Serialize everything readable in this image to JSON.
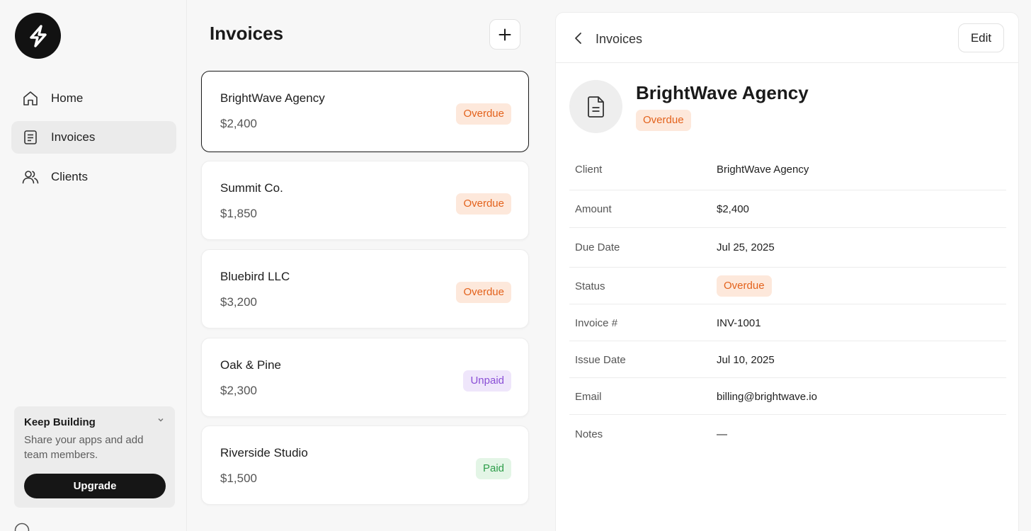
{
  "sidebar": {
    "items": [
      {
        "label": "Home",
        "icon": "home-icon"
      },
      {
        "label": "Invoices",
        "icon": "invoice-icon",
        "active": true
      },
      {
        "label": "Clients",
        "icon": "users-icon"
      }
    ],
    "promo": {
      "title": "Keep Building",
      "text": "Share your apps and add team members.",
      "button": "Upgrade"
    }
  },
  "list": {
    "title": "Invoices",
    "cards": [
      {
        "name": "BrightWave Agency",
        "amount": "$2,400",
        "status": "Overdue"
      },
      {
        "name": "Summit Co.",
        "amount": "$1,850",
        "status": "Overdue"
      },
      {
        "name": "Bluebird LLC",
        "amount": "$3,200",
        "status": "Overdue"
      },
      {
        "name": "Oak & Pine",
        "amount": "$2,300",
        "status": "Unpaid"
      },
      {
        "name": "Riverside Studio",
        "amount": "$1,500",
        "status": "Paid"
      }
    ]
  },
  "detail": {
    "back_label": "Invoices",
    "edit_label": "Edit",
    "title": "BrightWave Agency",
    "status": "Overdue",
    "fields": [
      {
        "label": "Client",
        "value": "BrightWave Agency"
      },
      {
        "label": "Amount",
        "value": "$2,400"
      },
      {
        "label": "Due Date",
        "value": "Jul 25, 2025"
      },
      {
        "label": "Status",
        "value": "Overdue"
      },
      {
        "label": "Invoice #",
        "value": "INV-1001"
      },
      {
        "label": "Issue Date",
        "value": "Jul 10, 2025"
      },
      {
        "label": "Email",
        "value": "billing@brightwave.io"
      },
      {
        "label": "Notes",
        "value": "—"
      }
    ]
  },
  "colors": {
    "overdue_bg": "#fde8db",
    "overdue_text": "#e3621c",
    "unpaid_bg": "#efe6fb",
    "unpaid_text": "#8a4fd6",
    "paid_bg": "#e3f5e6",
    "paid_text": "#2e9d4a"
  }
}
